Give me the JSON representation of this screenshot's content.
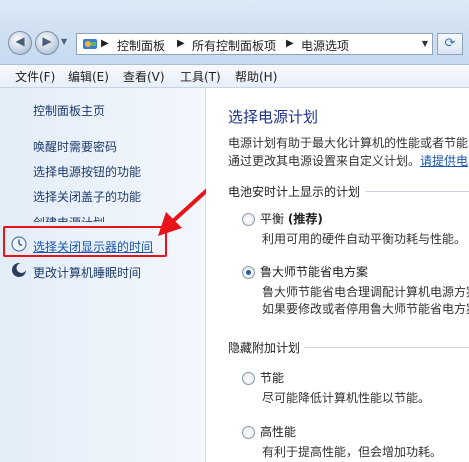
{
  "addressbar": {
    "breadcrumbs": [
      "控制面板",
      "所有控制面板项",
      "电源选项"
    ]
  },
  "menubar": {
    "items": [
      "文件(F)",
      "编辑(E)",
      "查看(V)",
      "工具(T)",
      "帮助(H)"
    ]
  },
  "sidebar": {
    "home": "控制面板主页",
    "links": [
      "唤醒时需要密码",
      "选择电源按钮的功能",
      "选择关闭盖子的功能",
      "创建电源计划",
      "选择关闭显示器的时间",
      "更改计算机睡眠时间"
    ]
  },
  "main": {
    "title": "选择电源计划",
    "desc_line1": "电源计划有助于最大化计算机的性能或者节能",
    "desc_line2": "通过更改其电源设置来自定义计划。",
    "desc_link": "请提供电",
    "section1": "电池安时计上显示的计划",
    "plans": [
      {
        "name": "平衡",
        "tag": "(推荐)",
        "desc": "利用可用的硬件自动平衡功耗与性能。",
        "checked": false
      },
      {
        "name": "鲁大师节能省电方案",
        "desc1": "鲁大师节能省电合理调配计算机电源方案",
        "desc2": "如果要修改或者停用鲁大师节能省电方案",
        "checked": true
      }
    ],
    "section2": "隐藏附加计划",
    "hidden_plans": [
      {
        "name": "节能",
        "desc": "尽可能降低计算机性能以节能。"
      },
      {
        "name": "高性能",
        "desc": "有利于提高性能，但会增加功耗。"
      }
    ]
  },
  "colors": {
    "annotation": "#e8141c",
    "link": "#1a55b0",
    "title": "#1e3287"
  }
}
